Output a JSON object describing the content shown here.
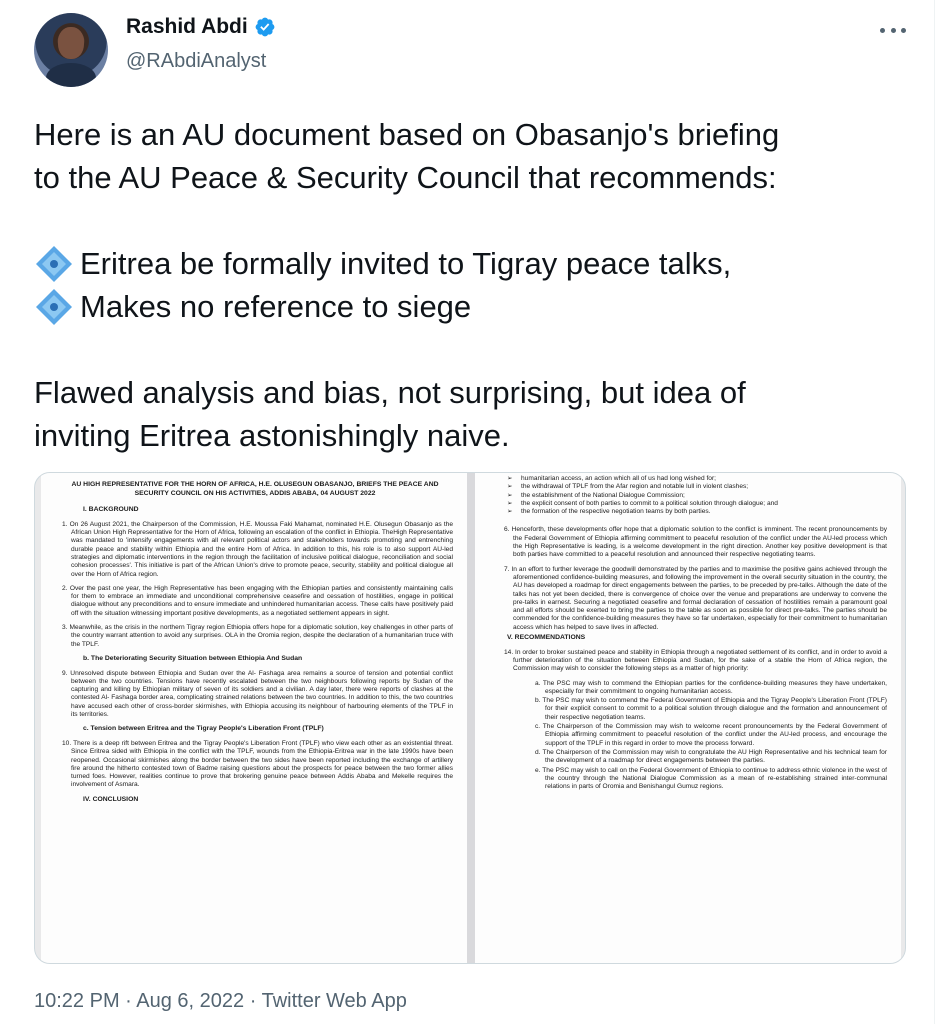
{
  "author": {
    "name": "Rashid Abdi",
    "handle": "@RAbdiAnalyst",
    "verified_icon": "verified-badge-icon",
    "accent_color": "#1d9bf0"
  },
  "tweet": {
    "line1": "Here is an AU document based on Obasanjo's briefing",
    "line2": "to the AU Peace & Security Council that recommends:",
    "bullet1": "Eritrea be formally invited to Tigray peace talks,",
    "bullet2": "Makes no reference to siege",
    "line3": "Flawed analysis and bias, not surprising, but idea of",
    "line4": "inviting Eritrea astonishingly naive."
  },
  "meta": {
    "time": "10:22 PM",
    "sep1": " · ",
    "date": "Aug 6, 2022",
    "sep2": " · ",
    "client": "Twitter Web App"
  },
  "document": {
    "left": {
      "title": "AU HIGH REPRESENTATIVE FOR THE HORN OF AFRICA, H.E. OLUSEGUN OBASANJO, BRIEFS THE PEACE AND SECURITY COUNCIL ON HIS ACTIVITIES, ADDIS ABABA, 04 AUGUST 2022",
      "section1": "I.        BACKGROUND",
      "p1": "1.   On 26 August 2021, the Chairperson of the Commission, H.E. Moussa Faki Mahamat, nominated H.E. Olusegun Obasanjo as the African Union High Representative for the Horn of Africa, following an escalation of the conflict in Ethiopia. TheHigh Representative was mandated to 'intensify engagements with all relevant political actors and stakeholders towards promoting and entrenching durable peace and stability within Ethiopia and the entire Horn of Africa. In addition to this, his role is to also support AU-led strategies and diplomatic interventions in the region through the facilitation of inclusive political dialogue, reconciliation and social cohesion processes'. This initiative is part of the African Union's drive to promote peace, security, stability and political dialogue all over the Horn of Africa region.",
      "p2": "2.   Over the past one year, the High Representative has been engaging with the Ethiopian parties and consistently maintaining calls for them to embrace an immediate and unconditional comprehensive ceasefire and cessation of hostilities, engage in political dialogue without any preconditions and to ensure immediate and unhindered humanitarian access. These calls have positively paid off with the situation witnessing important positive developments, as a negotiated settlement appears in sight.",
      "p3": "3.   Meanwhile, as the crisis in the northern Tigray region Ethiopia offers hope for a diplomatic solution, key challenges in other parts of the country warrant attention to avoid any surprises. OLA in the Oromia region, despite the declaration of a humanitarian truce with the TPLF.",
      "section_b": "b.   The Deteriorating Security Situation between Ethiopia And Sudan",
      "p9": "9.   Unresolved dispute between Ethiopia and Sudan over the Al- Fashaga area remains a source of tension and potential conflict between the two countries. Tensions have recently escalated between the two neighbours following reports by Sudan of the capturing and killing by Ethiopian military of seven of its soldiers and a civilian. A day later, there were reports of clashes at the contested Al- Fashaga border area, complicating strained relations between the two countries. In addition to this, the two countries have accused each other of cross-border skirmishes, with Ethiopia accusing its neighbour of harbouring elements of the TPLF in its territories.",
      "section_c": "c.   Tension between Eritrea and the Tigray People's Liberation Front (TPLF)",
      "p10": "10. There is a deep rift between Eritrea and the Tigray People's Liberation Front (TPLF) who view each other as an existential threat. Since Eritrea sided with Ethiopia in the conflict with the TPLF, wounds from the Ethiopia-Eritrea war in the late 1990s have been reopened. Occasional skirmishes along the border between the two sides have been reported including the exchange of artillery fire around the hitherto contested town of Badme raising questions about the prospects for peace between the two former allies turned foes. However, realities continue to prove that brokering genuine peace between Addis Ababa and Mekelle requires the involvement of Asmara.",
      "section_iv": "IV.       CONCLUSION"
    },
    "right": {
      "intro": "humanitarian access, an action which all of us had long wished for;",
      "b1": "the withdrawal of TPLF from the Afar region and notable lull in violent clashes;",
      "b2": "the establishment of the National Dialogue Commission;",
      "b3": "the explicit consent of both parties to commit to a political solution through dialogue; and",
      "b4": "the formation of the respective negotiation teams by both parties.",
      "p6": "6.   Henceforth, these developments offer hope that a diplomatic solution to the conflict is imminent. The recent pronouncements by the Federal Government of Ethiopia affirming commitment to peaceful resolution of the conflict under the AU-led process which the High Representative is leading, is a welcome development in the right direction. Another key positive development is that both parties have committed to a peaceful resolution and announced their respective negotiating teams.",
      "p7": "7.   In an effort to further leverage the goodwill demonstrated by the parties and to maximise the positive gains achieved through the aforementioned confidence-building measures, and following the improvement in the overall security situation in the country, the AU has developed a roadmap for direct engagements between the parties, to be preceded by pre-talks. Although the date of the talks has not yet been decided, there is convergence of choice over the venue and preparations are underway to convene the pre-talks in earnest. Securing a negotiated ceasefire and formal declaration of cessation of hostilities remain a paramount goal and all efforts should be exerted to bring the parties to the table as soon as possible for direct pre-talks. The parties should be commended for the confidence-building measures they have so far undertaken, especially for their commitment to humanitarian access which has helped to save lives in affected.",
      "section_v": "V.        RECOMMENDATIONS",
      "p14": "14. In order to broker sustained peace and stability in Ethiopia through a negotiated settlement of its conflict, and in order to avoid a further deterioration of the situation between Ethiopia and Sudan, for the sake of a stable the Horn of Africa region, the Commission may wish to consider the following steps as a matter of high priority:",
      "ra": "a.   The PSC may wish to commend the Ethiopian parties for the confidence-building measures they have undertaken, especially for their commitment to ongoing humanitarian access.",
      "rb": "b.   The PSC may wish to commend the Federal Government of Ethiopia and the Tigray People's Liberation Front (TPLF) for their explicit consent to commit to a political solution through dialogue and the formation and announcement of their respective negotiation teams.",
      "rc": "c.   The Chairperson of the Commission may wish to welcome recent pronouncements by the Federal Government of Ethiopia affirming commitment to peaceful resolution of the conflict under the AU-led process, and encourage the support of the TPLF in this regard  in order to move the process forward.",
      "rd": "d.   The Chairperson of the Commission may wish to congratulate the AU High Representative and his technical team for the development of a roadmap for direct engagements between the parties.",
      "re": "e.   The PSC may wish to call on the Federal Government of Ethiopia to continue to address ethnic violence in the west of the country through the National Dialogue Commission as a mean of re-establishing strained inter-communal relations in parts of Oromia and Benishangul Gumuz regions."
    }
  }
}
